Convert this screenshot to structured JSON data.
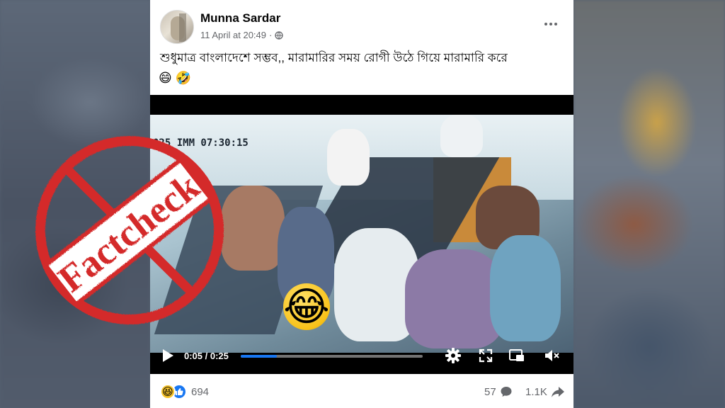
{
  "post": {
    "author": "Munna Sardar",
    "timestamp": "11 April at 20:49",
    "visibility_icon": "globe-icon",
    "caption": "শুধুমাত্র বাংলাদেশে সম্ভব,, মারামারির সময় রোগী উঠে গিয়ে মারামারি করে",
    "caption_emojis": "😄 🤣"
  },
  "video": {
    "overlay_timestamp": "025 IMM 07:30:15",
    "overlay_emoji": "😂",
    "current_time": "0:05 / 0:25",
    "progress": 0.2
  },
  "footer": {
    "reaction_icons": [
      "haha-icon",
      "like-icon"
    ],
    "reactions_count": "694",
    "comments_count": "57",
    "shares_count": "1.1K"
  },
  "stamp": {
    "text": "Factcheck",
    "color": "#d42a2a"
  }
}
